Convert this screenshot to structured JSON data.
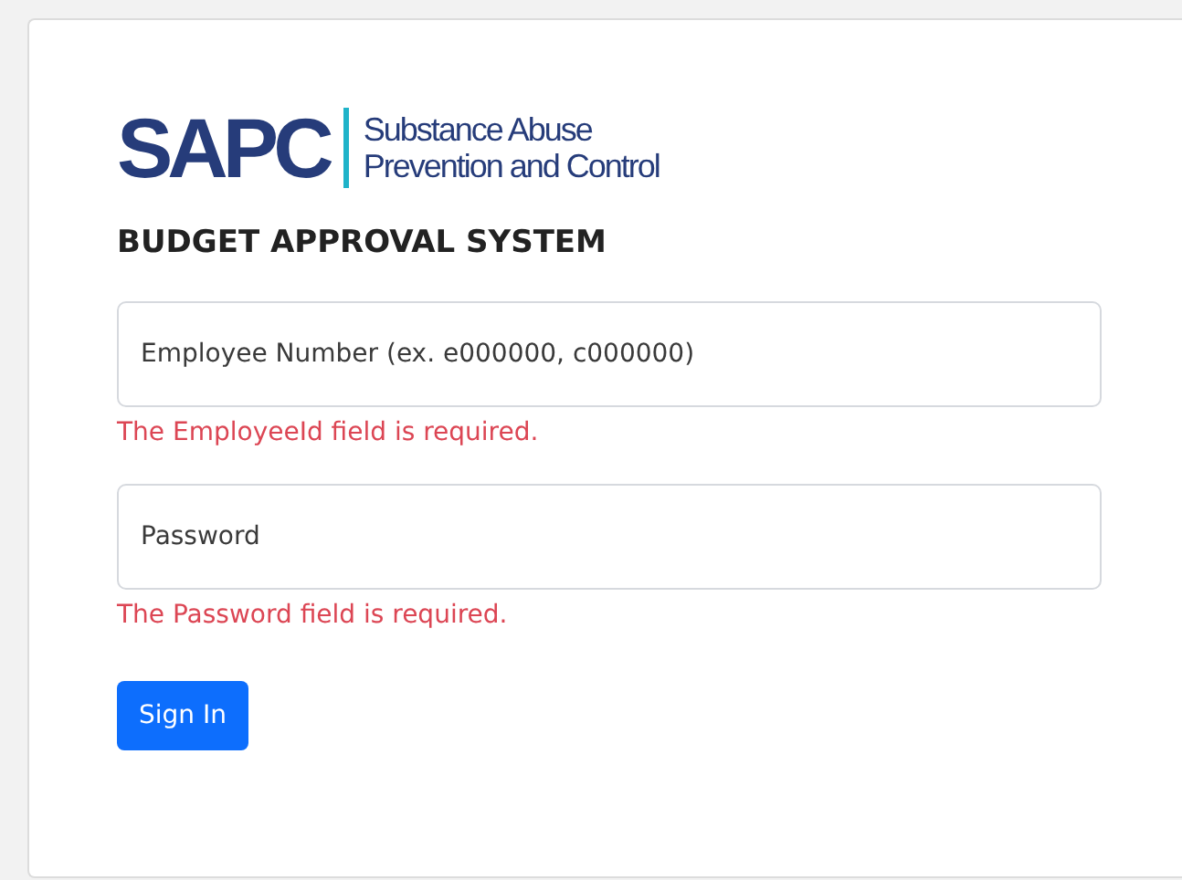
{
  "logo": {
    "mark": "SAPC",
    "subtitle_lines": [
      "Substance Abuse",
      "Prevention and Control"
    ]
  },
  "heading": "BUDGET APPROVAL SYSTEM",
  "fields": [
    {
      "placeholder": "Employee Number (ex. e000000, c000000)",
      "error": "The EmployeeId field is required."
    },
    {
      "placeholder": "Password",
      "error": "The Password field is required."
    }
  ],
  "submit": {
    "label": "Sign In"
  }
}
